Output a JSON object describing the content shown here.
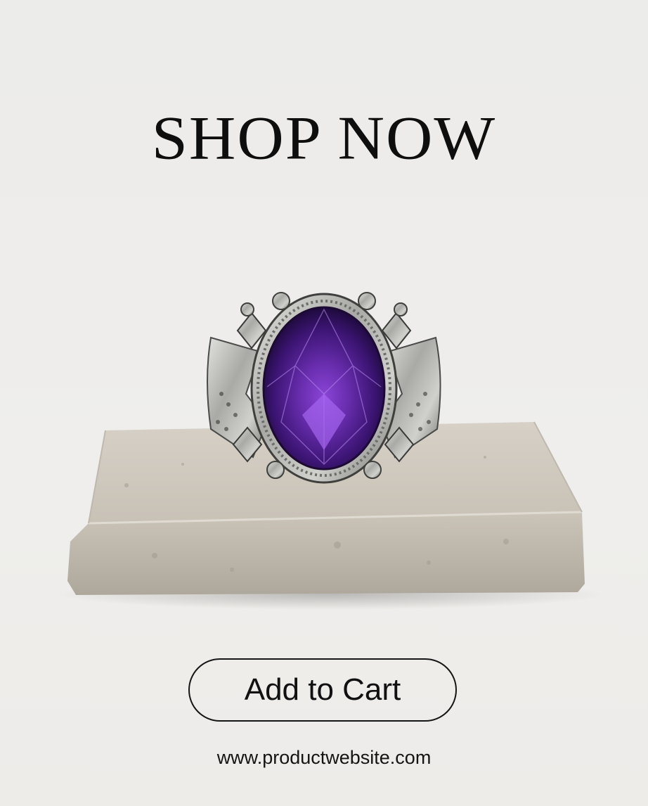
{
  "headline": "SHOP NOW",
  "product": {
    "image_alt": "Silver ring with oval purple gemstone on a stone block",
    "gem_color": "#5b2a8f",
    "metal_color": "#b9b9b6",
    "stone_color": "#cfc9bf"
  },
  "cta": {
    "label": "Add to Cart"
  },
  "footer": {
    "website": "www.productwebsite.com"
  },
  "colors": {
    "background": "#eeedeb",
    "text": "#111111"
  }
}
